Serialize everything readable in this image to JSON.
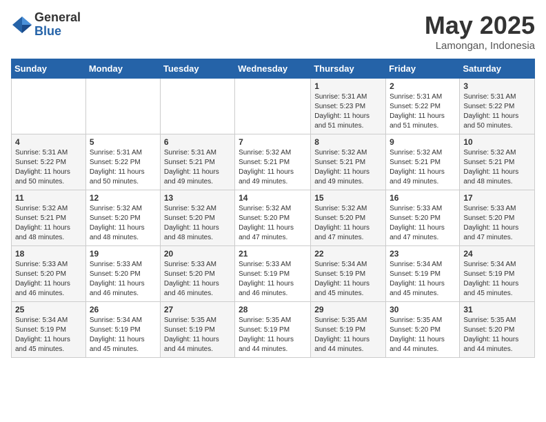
{
  "logo": {
    "general": "General",
    "blue": "Blue"
  },
  "header": {
    "month": "May 2025",
    "location": "Lamongan, Indonesia"
  },
  "weekdays": [
    "Sunday",
    "Monday",
    "Tuesday",
    "Wednesday",
    "Thursday",
    "Friday",
    "Saturday"
  ],
  "weeks": [
    [
      {
        "day": "",
        "info": ""
      },
      {
        "day": "",
        "info": ""
      },
      {
        "day": "",
        "info": ""
      },
      {
        "day": "",
        "info": ""
      },
      {
        "day": "1",
        "info": "Sunrise: 5:31 AM\nSunset: 5:23 PM\nDaylight: 11 hours\nand 51 minutes."
      },
      {
        "day": "2",
        "info": "Sunrise: 5:31 AM\nSunset: 5:22 PM\nDaylight: 11 hours\nand 51 minutes."
      },
      {
        "day": "3",
        "info": "Sunrise: 5:31 AM\nSunset: 5:22 PM\nDaylight: 11 hours\nand 50 minutes."
      }
    ],
    [
      {
        "day": "4",
        "info": "Sunrise: 5:31 AM\nSunset: 5:22 PM\nDaylight: 11 hours\nand 50 minutes."
      },
      {
        "day": "5",
        "info": "Sunrise: 5:31 AM\nSunset: 5:22 PM\nDaylight: 11 hours\nand 50 minutes."
      },
      {
        "day": "6",
        "info": "Sunrise: 5:31 AM\nSunset: 5:21 PM\nDaylight: 11 hours\nand 49 minutes."
      },
      {
        "day": "7",
        "info": "Sunrise: 5:32 AM\nSunset: 5:21 PM\nDaylight: 11 hours\nand 49 minutes."
      },
      {
        "day": "8",
        "info": "Sunrise: 5:32 AM\nSunset: 5:21 PM\nDaylight: 11 hours\nand 49 minutes."
      },
      {
        "day": "9",
        "info": "Sunrise: 5:32 AM\nSunset: 5:21 PM\nDaylight: 11 hours\nand 49 minutes."
      },
      {
        "day": "10",
        "info": "Sunrise: 5:32 AM\nSunset: 5:21 PM\nDaylight: 11 hours\nand 48 minutes."
      }
    ],
    [
      {
        "day": "11",
        "info": "Sunrise: 5:32 AM\nSunset: 5:21 PM\nDaylight: 11 hours\nand 48 minutes."
      },
      {
        "day": "12",
        "info": "Sunrise: 5:32 AM\nSunset: 5:20 PM\nDaylight: 11 hours\nand 48 minutes."
      },
      {
        "day": "13",
        "info": "Sunrise: 5:32 AM\nSunset: 5:20 PM\nDaylight: 11 hours\nand 48 minutes."
      },
      {
        "day": "14",
        "info": "Sunrise: 5:32 AM\nSunset: 5:20 PM\nDaylight: 11 hours\nand 47 minutes."
      },
      {
        "day": "15",
        "info": "Sunrise: 5:32 AM\nSunset: 5:20 PM\nDaylight: 11 hours\nand 47 minutes."
      },
      {
        "day": "16",
        "info": "Sunrise: 5:33 AM\nSunset: 5:20 PM\nDaylight: 11 hours\nand 47 minutes."
      },
      {
        "day": "17",
        "info": "Sunrise: 5:33 AM\nSunset: 5:20 PM\nDaylight: 11 hours\nand 47 minutes."
      }
    ],
    [
      {
        "day": "18",
        "info": "Sunrise: 5:33 AM\nSunset: 5:20 PM\nDaylight: 11 hours\nand 46 minutes."
      },
      {
        "day": "19",
        "info": "Sunrise: 5:33 AM\nSunset: 5:20 PM\nDaylight: 11 hours\nand 46 minutes."
      },
      {
        "day": "20",
        "info": "Sunrise: 5:33 AM\nSunset: 5:20 PM\nDaylight: 11 hours\nand 46 minutes."
      },
      {
        "day": "21",
        "info": "Sunrise: 5:33 AM\nSunset: 5:19 PM\nDaylight: 11 hours\nand 46 minutes."
      },
      {
        "day": "22",
        "info": "Sunrise: 5:34 AM\nSunset: 5:19 PM\nDaylight: 11 hours\nand 45 minutes."
      },
      {
        "day": "23",
        "info": "Sunrise: 5:34 AM\nSunset: 5:19 PM\nDaylight: 11 hours\nand 45 minutes."
      },
      {
        "day": "24",
        "info": "Sunrise: 5:34 AM\nSunset: 5:19 PM\nDaylight: 11 hours\nand 45 minutes."
      }
    ],
    [
      {
        "day": "25",
        "info": "Sunrise: 5:34 AM\nSunset: 5:19 PM\nDaylight: 11 hours\nand 45 minutes."
      },
      {
        "day": "26",
        "info": "Sunrise: 5:34 AM\nSunset: 5:19 PM\nDaylight: 11 hours\nand 45 minutes."
      },
      {
        "day": "27",
        "info": "Sunrise: 5:35 AM\nSunset: 5:19 PM\nDaylight: 11 hours\nand 44 minutes."
      },
      {
        "day": "28",
        "info": "Sunrise: 5:35 AM\nSunset: 5:19 PM\nDaylight: 11 hours\nand 44 minutes."
      },
      {
        "day": "29",
        "info": "Sunrise: 5:35 AM\nSunset: 5:19 PM\nDaylight: 11 hours\nand 44 minutes."
      },
      {
        "day": "30",
        "info": "Sunrise: 5:35 AM\nSunset: 5:20 PM\nDaylight: 11 hours\nand 44 minutes."
      },
      {
        "day": "31",
        "info": "Sunrise: 5:35 AM\nSunset: 5:20 PM\nDaylight: 11 hours\nand 44 minutes."
      }
    ]
  ]
}
